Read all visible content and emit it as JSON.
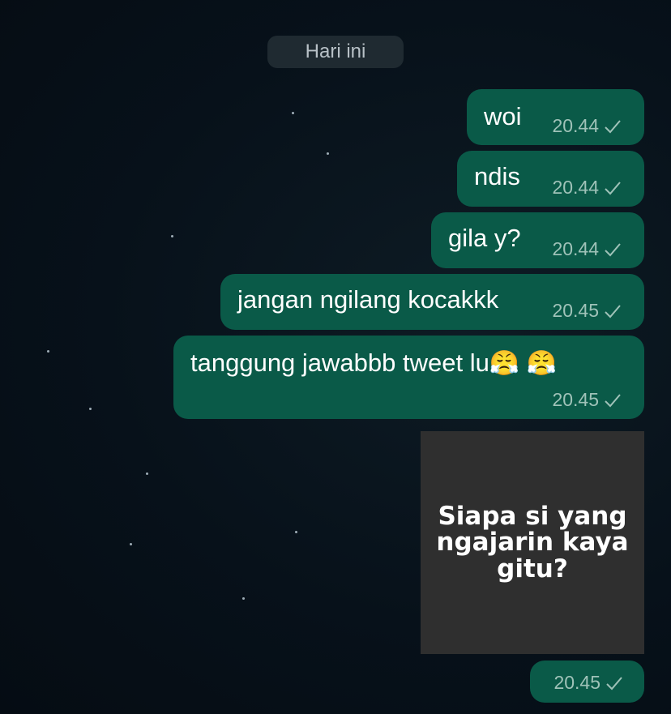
{
  "date_label": "Hari ini",
  "messages": [
    {
      "text": "woi",
      "time": "20.44"
    },
    {
      "text": "ndis",
      "time": "20.44"
    },
    {
      "text": "gila y?",
      "time": "20.44"
    },
    {
      "text": "jangan ngilang kocakkk",
      "time": "20.45"
    },
    {
      "text": "tanggung jawabbb tweet lu",
      "emoji": "😤 😤",
      "time": "20.45"
    }
  ],
  "image_message": {
    "caption": "Siapa si yang ngajarin kaya gitu?",
    "time": "20.45"
  },
  "colors": {
    "bubble": "#0a5a48",
    "meta_text": "#9fc2b8",
    "date_pill": "#1f2a31",
    "image_bg": "#2f2f2f"
  }
}
